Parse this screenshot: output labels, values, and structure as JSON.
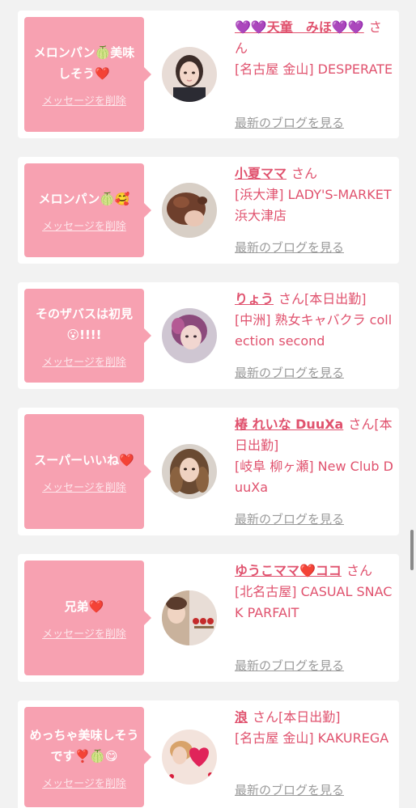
{
  "messages": [
    {
      "text": "メロンパン🍈美味しそう❤️",
      "delete_label": "メッセージを削除",
      "name": "💜💜天童　みほ💜💜",
      "san": "さん",
      "shop": "[名古屋 金山] DESPERATE",
      "blog_label": "最新のブログを見る"
    },
    {
      "text": "メロンパン🍈🥰",
      "delete_label": "メッセージを削除",
      "name": "小夏ママ",
      "san": "さん",
      "shop": "[浜大津] LADY'S-MARKET 浜大津店",
      "blog_label": "最新のブログを見る"
    },
    {
      "text": "そのザバスは初見😮!!!!",
      "delete_label": "メッセージを削除",
      "name": "りょう",
      "san": "さん[本日出勤]",
      "shop": "[中洲] 熟女キャバクラ collection second",
      "blog_label": "最新のブログを見る"
    },
    {
      "text": "スーパーいいね❤️",
      "delete_label": "メッセージを削除",
      "name": "椿 れいな DuuXa",
      "san": "さん[本日出勤]",
      "shop": "[岐阜 柳ヶ瀬] New Club DuuXa",
      "blog_label": "最新のブログを見る"
    },
    {
      "text": "兄弟❤️",
      "delete_label": "メッセージを削除",
      "name": "ゆうこママ❤️ココ",
      "san": "さん",
      "shop": "[北名古屋] CASUAL SNACK PARFAIT",
      "blog_label": "最新のブログを見る"
    },
    {
      "text": "めっちゃ美味しそうです❣️🍈😋",
      "delete_label": "メッセージを削除",
      "name": "浪",
      "san": "さん[本日出勤]",
      "shop": "[名古屋 金山] KAKUREGA",
      "blog_label": "最新のブログを見る"
    }
  ],
  "colors": {
    "accent": "#e0526e",
    "bubble": "#f7a1b1",
    "background": "#f2f2f2",
    "link_gray": "#9a9a9a"
  }
}
